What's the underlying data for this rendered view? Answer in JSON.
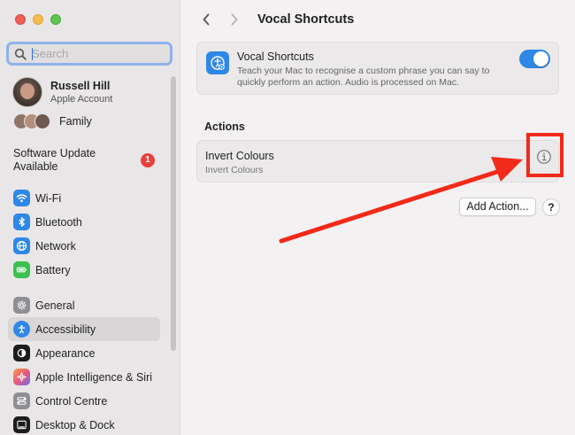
{
  "window": {
    "title": "Vocal Shortcuts"
  },
  "sidebar": {
    "search_placeholder": "Search",
    "account": {
      "name": "Russell Hill",
      "subtitle": "Apple Account"
    },
    "family_label": "Family",
    "update": {
      "label": "Software Update Available",
      "badge": "1"
    },
    "items": [
      {
        "label": "Wi-Fi",
        "icon": "wifi-icon",
        "color": "#2f88e6"
      },
      {
        "label": "Bluetooth",
        "icon": "bluetooth-icon",
        "color": "#2f88e6"
      },
      {
        "label": "Network",
        "icon": "globe-icon",
        "color": "#2f88e6"
      },
      {
        "label": "Battery",
        "icon": "battery-icon",
        "color": "#3cc04f"
      },
      {
        "label": "General",
        "icon": "gear-icon",
        "color": "#8e8e93"
      },
      {
        "label": "Accessibility",
        "icon": "accessibility-icon",
        "color": "#2f88e6"
      },
      {
        "label": "Appearance",
        "icon": "appearance-icon",
        "color": "#1c1c1e"
      },
      {
        "label": "Apple Intelligence & Siri",
        "icon": "siri-icon",
        "color": "#e85a7a"
      },
      {
        "label": "Control Centre",
        "icon": "control-centre-icon",
        "color": "#8e8e93"
      },
      {
        "label": "Desktop & Dock",
        "icon": "dock-icon",
        "color": "#1c1c1e"
      }
    ]
  },
  "main": {
    "card": {
      "title": "Vocal Shortcuts",
      "description": "Teach your Mac to recognise a custom phrase you can say to quickly perform an action. Audio is processed on Mac.",
      "toggle_on": true
    },
    "section_label": "Actions",
    "action": {
      "title": "Invert Colours",
      "subtitle": "Invert Colours"
    },
    "add_button_label": "Add Action...",
    "help_button_label": "?"
  },
  "colors": {
    "accent": "#2f88e6",
    "annotation": "#f22a1a",
    "badge": "#e8403a"
  }
}
